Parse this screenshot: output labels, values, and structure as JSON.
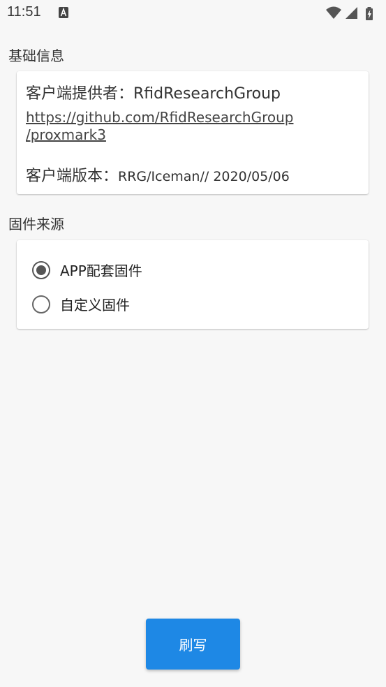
{
  "status_bar": {
    "time": "11:51",
    "left_icons": [
      "a-notification-icon"
    ],
    "right_icons": [
      "wifi-icon",
      "signal-icon",
      "battery-charging-icon"
    ]
  },
  "basic_info": {
    "section_title": "基础信息",
    "provider_label": "客户端提供者：",
    "provider_value": "RfidResearchGroup",
    "link_line1": "https://github.com/RfidResearchGroup",
    "link_line2": "/proxmark3",
    "version_label": "客户端版本：",
    "version_value": "RRG/Iceman// 2020/05/06"
  },
  "firmware_source": {
    "section_title": "固件来源",
    "options": [
      {
        "label": "APP配套固件",
        "selected": true
      },
      {
        "label": "自定义固件",
        "selected": false
      }
    ]
  },
  "action": {
    "flash_label": "刷写",
    "color": "#1e88e5"
  }
}
